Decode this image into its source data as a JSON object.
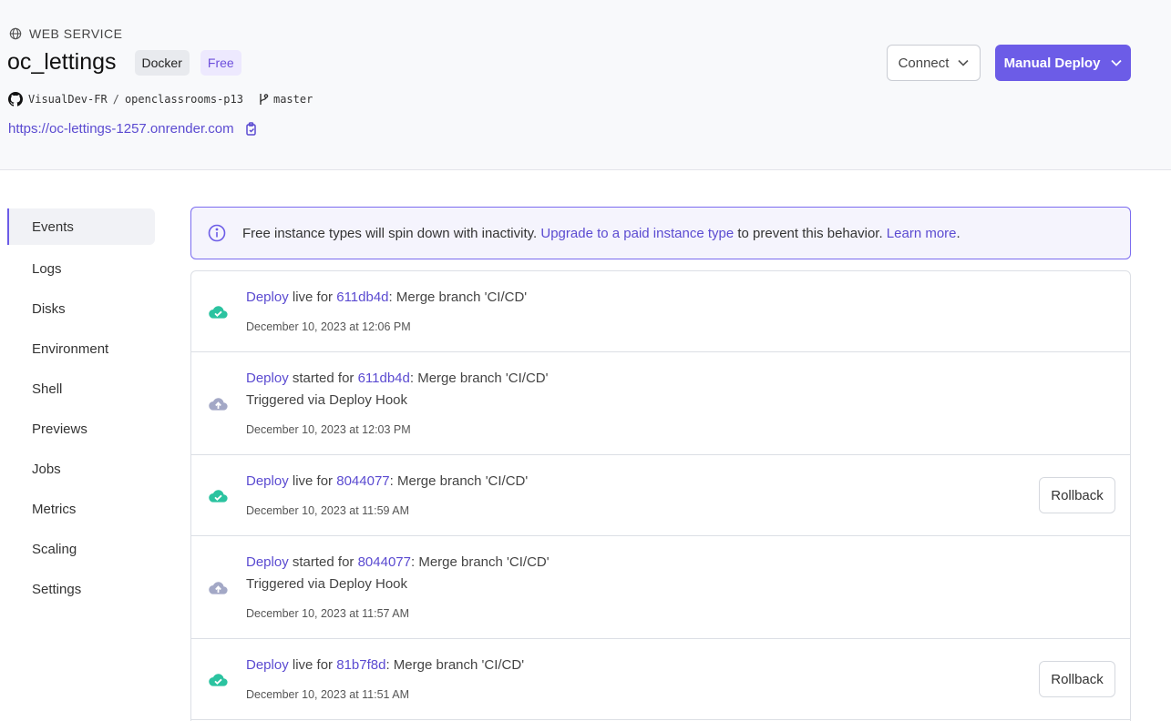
{
  "service": {
    "type_label": "WEB SERVICE",
    "name": "oc_lettings",
    "badges": [
      "Docker",
      "Free"
    ],
    "repo_owner": "VisualDev-FR",
    "repo_sep": "/",
    "repo_name": "openclassrooms-p13",
    "branch": "master",
    "url": "https://oc-lettings-1257.onrender.com"
  },
  "actions": {
    "connect_label": "Connect",
    "deploy_label": "Manual Deploy"
  },
  "sidebar": {
    "items": [
      {
        "label": "Events",
        "active": true
      },
      {
        "label": "Logs"
      },
      {
        "label": "Disks"
      },
      {
        "label": "Environment"
      },
      {
        "label": "Shell"
      },
      {
        "label": "Previews"
      },
      {
        "label": "Jobs"
      },
      {
        "label": "Metrics"
      },
      {
        "label": "Scaling"
      },
      {
        "label": "Settings"
      }
    ]
  },
  "notice": {
    "text": "Free instance types will spin down with inactivity.",
    "link1": "Upgrade to a paid instance type",
    "text2": "to prevent this behavior.",
    "link2": "Learn more",
    "period": "."
  },
  "events": [
    {
      "status": "live",
      "icon": "cloud-check-icon",
      "deploy": "Deploy",
      "verb": "live for",
      "commit": "611db4d",
      "message": ": Merge branch 'CI/CD'",
      "time": "December 10, 2023 at 12:06 PM"
    },
    {
      "status": "started",
      "icon": "cloud-upload-icon",
      "deploy": "Deploy",
      "verb": "started for",
      "commit": "611db4d",
      "message": ": Merge branch 'CI/CD'",
      "trigger": "Triggered via Deploy Hook",
      "time": "December 10, 2023 at 12:03 PM"
    },
    {
      "status": "live",
      "icon": "cloud-check-icon",
      "deploy": "Deploy",
      "verb": "live for",
      "commit": "8044077",
      "message": ": Merge branch 'CI/CD'",
      "time": "December 10, 2023 at 11:59 AM",
      "rollback": "Rollback"
    },
    {
      "status": "started",
      "icon": "cloud-upload-icon",
      "deploy": "Deploy",
      "verb": "started for",
      "commit": "8044077",
      "message": ": Merge branch 'CI/CD'",
      "trigger": "Triggered via Deploy Hook",
      "time": "December 10, 2023 at 11:57 AM"
    },
    {
      "status": "live",
      "icon": "cloud-check-icon",
      "deploy": "Deploy",
      "verb": "live for",
      "commit": "81b7f8d",
      "message": ": Merge branch 'CI/CD'",
      "time": "December 10, 2023 at 11:51 AM",
      "rollback": "Rollback"
    }
  ],
  "colors": {
    "accent": "#6c5ce7",
    "link": "#5b4bd1",
    "success": "#2bc3a0",
    "pending": "#a3a8c6"
  }
}
